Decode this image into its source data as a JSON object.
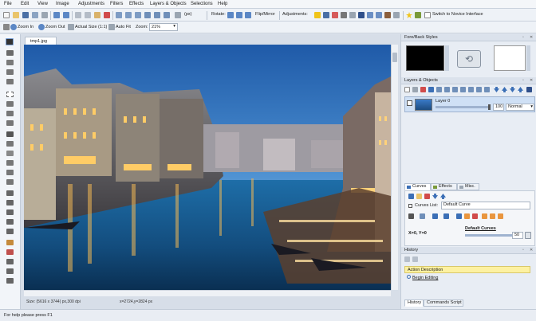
{
  "menu": [
    "File",
    "Edit",
    "View",
    "Image",
    "Adjustments",
    "Filters",
    "Effects",
    "Layers & Objects",
    "Selections",
    "Help"
  ],
  "toolbar": {
    "zoom_percent_small": "(px)",
    "rotate_label": "Rotate:",
    "flip_label": "Flip/Mirror",
    "adjustments_label": "Adjustments:",
    "switch_label": "Switch to Novice Interface"
  },
  "zoombar": {
    "zoom_in": "Zoom In",
    "zoom_out": "Zoom Out",
    "actual_size": "Actual Size (1:1)",
    "auto_fit": "Auto Fit",
    "zoom_label": "Zoom:",
    "zoom_value": "21%"
  },
  "document": {
    "tab_name": "tmp1.jpg",
    "size_info": "Size: (5616 x 3744) px,300 dpi",
    "cursor_info": "x=2724,y=2824 px"
  },
  "status": "For help please press F1",
  "panels": {
    "fore_back": {
      "title": "Fore/Back Styles",
      "foreground_color": "#000000",
      "background_color": "#ffffff"
    },
    "layers": {
      "title": "Layers & Objects",
      "layer_name": "Layer 0",
      "opacity": "100",
      "blend_mode": "Normal"
    },
    "curves": {
      "tabs": [
        "Curves",
        "Effects",
        "Misc."
      ],
      "list_label": "Curves List:",
      "list_value": "Default Curve",
      "coords": "X=0, Y=0",
      "curve_name": "Default Curves",
      "value": "50"
    },
    "history": {
      "title": "History",
      "items": [
        "Action Description",
        "Begin Editing"
      ],
      "tabs": [
        "History",
        "Commands Script"
      ]
    }
  },
  "colors": {
    "accent": "#3b6fb6",
    "history_highlight": "#fdf1a1",
    "layer_selected": "#cfe0f5"
  }
}
